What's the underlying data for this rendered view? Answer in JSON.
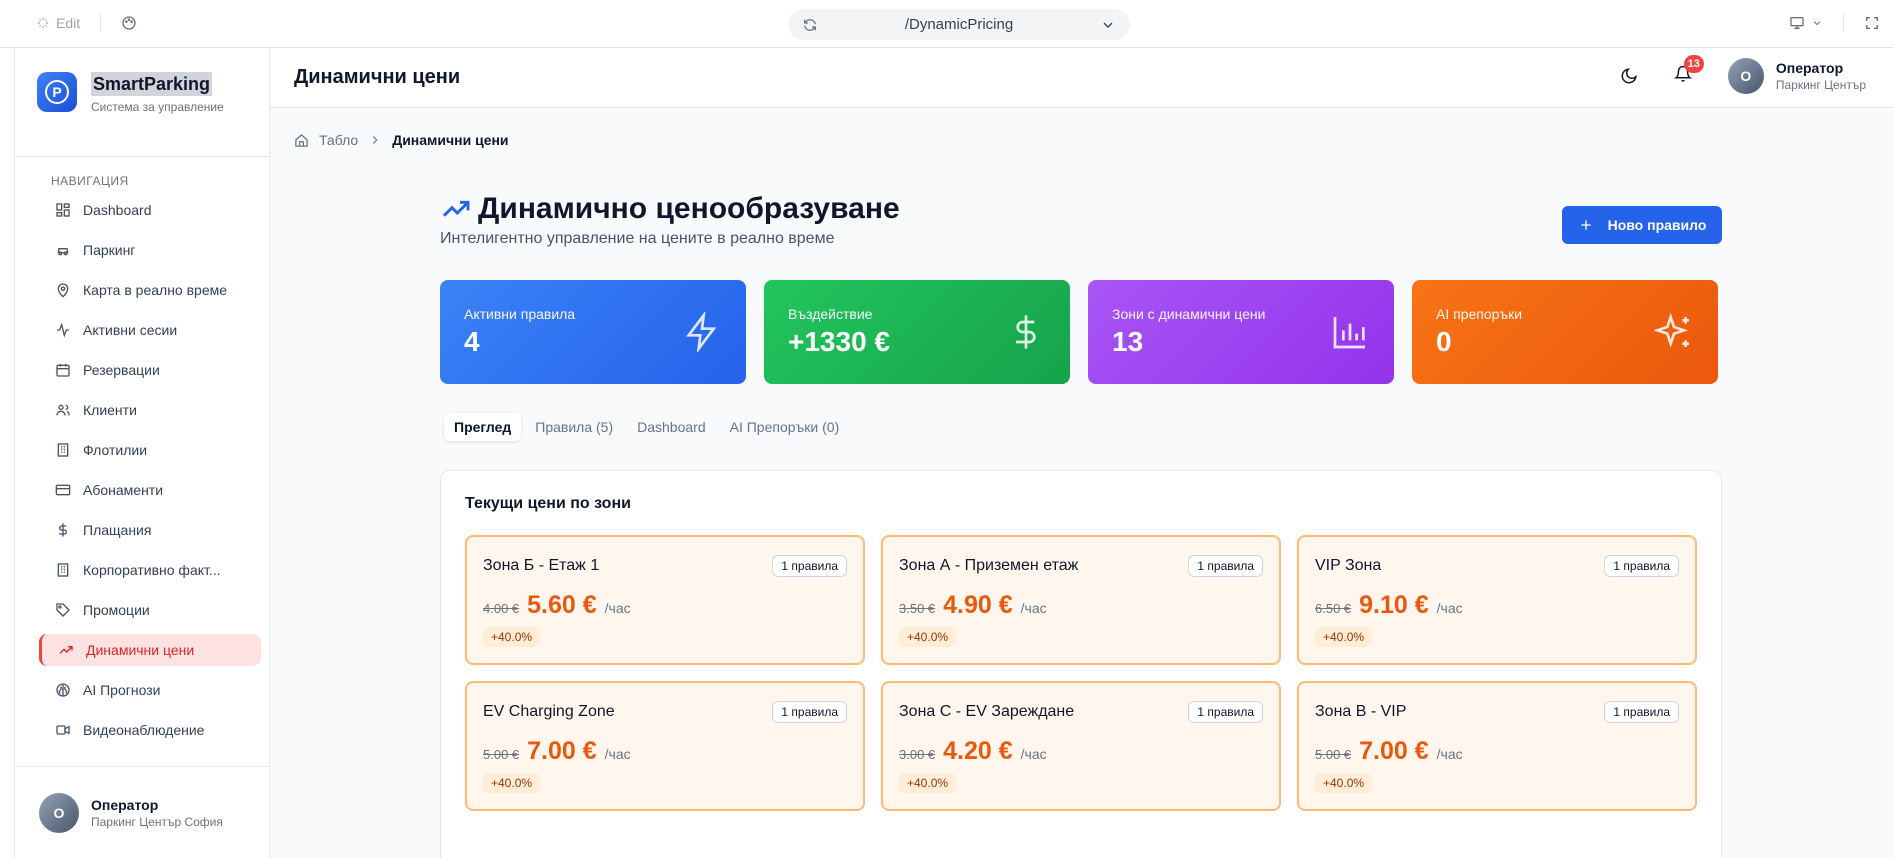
{
  "browser": {
    "edit_label": "Edit",
    "url": "/DynamicPricing"
  },
  "sidebar": {
    "brand_name": "SmartParking",
    "brand_sub": "Система за управление",
    "nav_title": "НАВИГАЦИЯ",
    "items": [
      {
        "label": "Dashboard",
        "icon": "grid-icon"
      },
      {
        "label": "Паркинг",
        "icon": "car-icon"
      },
      {
        "label": "Карта в реално време",
        "icon": "map-pin-icon"
      },
      {
        "label": "Активни сесии",
        "icon": "activity-icon"
      },
      {
        "label": "Резервации",
        "icon": "calendar-icon"
      },
      {
        "label": "Клиенти",
        "icon": "users-icon"
      },
      {
        "label": "Флотилии",
        "icon": "building-icon"
      },
      {
        "label": "Абонаменти",
        "icon": "card-icon"
      },
      {
        "label": "Плащания",
        "icon": "dollar-icon"
      },
      {
        "label": "Корпоративно факт...",
        "icon": "building-icon"
      },
      {
        "label": "Промоции",
        "icon": "tag-icon"
      },
      {
        "label": "Динамични цени",
        "icon": "trending-up-icon"
      },
      {
        "label": "AI Прогнози",
        "icon": "brain-icon"
      },
      {
        "label": "Видеонаблюдение",
        "icon": "video-icon"
      }
    ],
    "active_index": 11,
    "footer": {
      "avatar": "О",
      "name": "Оператор",
      "sub": "Паркинг Център София"
    }
  },
  "header": {
    "title": "Динамични цени",
    "notification_count": "13",
    "user_avatar": "О",
    "user_name": "Оператор",
    "user_sub": "Паркинг Център"
  },
  "breadcrumb": {
    "home": "Табло",
    "current": "Динамични цени"
  },
  "page": {
    "title": "Динамично ценообразуване",
    "subtitle": "Интелигентно управление на цените в реално време",
    "new_rule_label": "Ново правило"
  },
  "stats": [
    {
      "label": "Активни правила",
      "value": "4",
      "color": "#3b82f6",
      "icon": "zap-icon"
    },
    {
      "label": "Въздействие",
      "value": "+1330 €",
      "color": "#22c55e",
      "icon": "dollar-icon"
    },
    {
      "label": "Зони с динамични цени",
      "value": "13",
      "color": "#a855f7",
      "icon": "bar-chart-icon"
    },
    {
      "label": "AI препоръки",
      "value": "0",
      "color": "#f97316",
      "icon": "sparkles-icon"
    }
  ],
  "tabs": [
    {
      "label": "Преглед",
      "active": true
    },
    {
      "label": "Правила (5)",
      "active": false
    },
    {
      "label": "Dashboard",
      "active": false
    },
    {
      "label": "AI Препоръки (0)",
      "active": false
    }
  ],
  "zones_panel": {
    "title": "Текущи цени по зони",
    "per_hour": "/час",
    "zones": [
      {
        "name": "Зона Б - Етаж 1",
        "badge": "1 правила",
        "old": "4.00 €",
        "new": "5.60 €",
        "change": "+40.0%"
      },
      {
        "name": "Зона А - Приземен етаж",
        "badge": "1 правила",
        "old": "3.50 €",
        "new": "4.90 €",
        "change": "+40.0%"
      },
      {
        "name": "VIP Зона",
        "badge": "1 правила",
        "old": "6.50 €",
        "new": "9.10 €",
        "change": "+40.0%"
      },
      {
        "name": "EV Charging Zone",
        "badge": "1 правила",
        "old": "5.00 €",
        "new": "7.00 €",
        "change": "+40.0%"
      },
      {
        "name": "Зона C - EV Зареждане",
        "badge": "1 правила",
        "old": "3.00 €",
        "new": "4.20 €",
        "change": "+40.0%"
      },
      {
        "name": "Зона В - VIP",
        "badge": "1 правила",
        "old": "5.00 €",
        "new": "7.00 €",
        "change": "+40.0%"
      }
    ]
  }
}
